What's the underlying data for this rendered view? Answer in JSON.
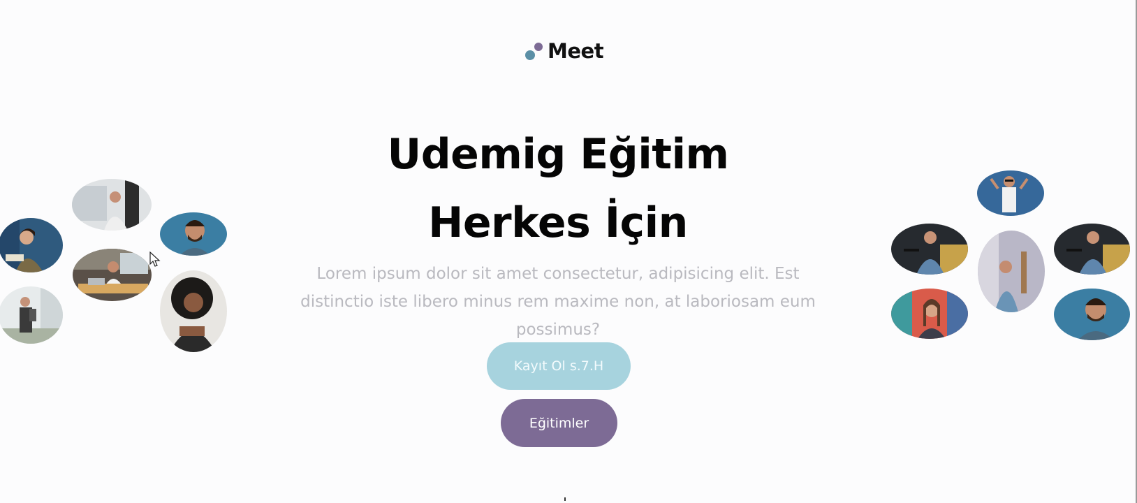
{
  "brand": {
    "name": "Meet",
    "dot_colors": [
      "#5b8fa6",
      "#7d6b95"
    ]
  },
  "hero": {
    "title_line1": "Udemig Eğitim",
    "title_line2": "Herkes İçin",
    "description": "Lorem ipsum dolor sit amet consectetur, adipisicing elit. Est distinctio iste libero minus rem maxime non, at laboriosam eum possimus?"
  },
  "buttons": {
    "register_label": "Kayıt Ol s.7.H",
    "courses_label": "Eğitimler"
  },
  "colors": {
    "accent_light": "#a7d3de",
    "accent_purple": "#7d6b95",
    "text_muted": "#b9b9bf"
  },
  "avatars_left": [
    "person-reading-photo",
    "man-with-phone-photo",
    "bearded-man-photo",
    "man-at-laptop-photo",
    "man-with-backpack-photo",
    "smiling-woman-photo"
  ],
  "avatars_right": [
    "man-sunglasses-photo",
    "man-on-couch-photo",
    "woman-sitting-photo",
    "man-on-couch-photo-2",
    "woman-graffiti-photo",
    "bearded-man-photo-2"
  ]
}
